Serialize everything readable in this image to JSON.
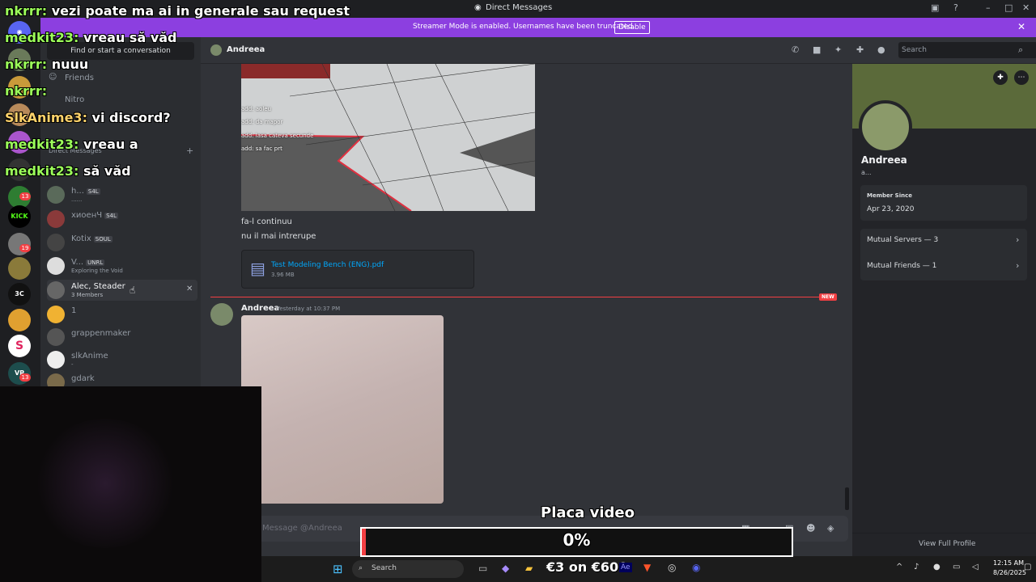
{
  "window": {
    "title": "Direct Messages"
  },
  "banner": {
    "text": "Streamer Mode is enabled. Usernames have been truncated.",
    "button": "Disable"
  },
  "sidebar": {
    "search_placeholder": "Find or start a conversation",
    "friends": "Friends",
    "nitro": "Nitro",
    "dm_header": "Direct Messages",
    "items": [
      {
        "name": "h...",
        "tag": "S4L",
        "sub": "......"
      },
      {
        "name": "xиоенЧ",
        "tag": "S4L",
        "sub": ""
      },
      {
        "name": "Kotix",
        "tag": "SOUL",
        "sub": ""
      },
      {
        "name": "V...",
        "tag": "UNRL",
        "sub": "Exploring the Void"
      },
      {
        "name": "Alec, Steader",
        "tag": "",
        "sub": "3 Members"
      },
      {
        "name": "1",
        "tag": "",
        "sub": ""
      },
      {
        "name": "grappenmaker",
        "tag": "",
        "sub": ""
      },
      {
        "name": "slkAnime",
        "tag": "",
        "sub": "-"
      },
      {
        "name": "gdark",
        "tag": "",
        "sub": ""
      }
    ]
  },
  "rail_badges": [
    "13",
    "19",
    "13"
  ],
  "rail_labels": {
    "kick": "KICK",
    "threec": "3C",
    "s": "S",
    "vp": "VP"
  },
  "chat": {
    "recipient": "Andreea",
    "search_placeholder": "Search",
    "screenshot_lines": [
      "add: aoleu",
      "add: da mapor",
      "add: lasa cateva secunde",
      "add: sa fac prt"
    ],
    "messages": [
      "fa-l continuu",
      "nu il mai intrerupe"
    ],
    "file": {
      "name": "Test Modeling Bench (ENG).pdf",
      "size": "3.96 MB"
    },
    "new_label": "NEW",
    "author": "Andreea",
    "timestamp": "Yesterday at 10:37 PM",
    "input_placeholder": "Message @Andreea"
  },
  "profile": {
    "name": "Andreea",
    "sub": "a...",
    "member_since_label": "Member Since",
    "member_since": "Apr 23, 2020",
    "mutual_servers": "Mutual Servers — 3",
    "mutual_friends": "Mutual Friends — 1",
    "view_full": "View Full Profile"
  },
  "taskbar": {
    "search": "Search",
    "overlay_text": "€3 on €600",
    "time": "12:15 AM",
    "date": "8/26/2025",
    "ae": "Ae"
  },
  "overlay_chat": [
    {
      "user": "nkrrr:",
      "msg": "vezi poate ma ai in generale sau request"
    },
    {
      "user": "medkit23:",
      "msg": "vreau să văd"
    },
    {
      "user": "nkrrr:",
      "msg": "nuuu"
    },
    {
      "user": "nkrrr:",
      "msg": ""
    },
    {
      "user": "SlkAnime3:",
      "msg": "vi discord?"
    },
    {
      "user": "medkit23:",
      "msg": "vreau a"
    },
    {
      "user": "medkit23:",
      "msg": "să văd"
    }
  ],
  "goal": {
    "label": "Placa video",
    "percent_text": "0%",
    "percent": 0.01
  },
  "colors": {
    "banner": "#8c3fe0",
    "new": "#f23f43",
    "accent": "#5865f2",
    "overlay_user": "#9cff5a"
  }
}
